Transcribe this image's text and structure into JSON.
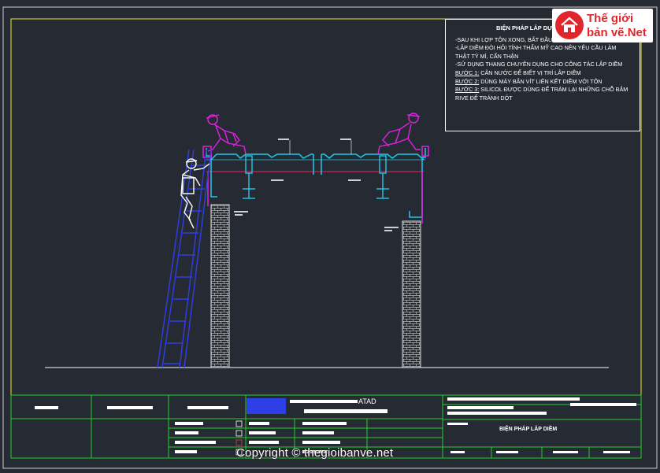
{
  "notes": {
    "title": "BIỆN PHÁP LẮP DỰNG",
    "lines": [
      "-SAU KHI LỢP TÔN XONG, BẮT ĐẦU LẮNG TÁC LẮP DIỀM",
      "-LẮP DIỀM ĐÒI HỎI TÍNH THẨM MỸ CAO NÊN YÊU CẦU LÀM",
      "THẬT TỶ MỈ, CẨN THẬN",
      "-SỬ DỤNG THANG CHUYÊN DỤNG CHO CÔNG TÁC LẮP DIỀM"
    ],
    "steps": [
      {
        "label": "BƯỚC 1:",
        "text": " CÂN NƯỚC ĐỂ BIẾT VỊ TRÍ LẮP DIỀM"
      },
      {
        "label": "BƯỚC 2:",
        "text": " DÙNG MÁY BẮN VÍT LIÊN KẾT DIỀM VỚI TÔN"
      },
      {
        "label": "BƯỚC 3:",
        "text": " SILICOL ĐƯỢC DÙNG ĐỂ TRÁM LẠI NHỮNG CHỖ BẮM"
      }
    ],
    "last_line": "RIVE ĐỂ TRÁNH DỘT"
  },
  "logo": {
    "line1": "Thế giới",
    "line2": "bản vẽ",
    "suffix": ".Net"
  },
  "title_block": {
    "company": "ATAD",
    "company_short": "ATAD",
    "sheet_title": "BIỆN PHÁP LẮP DIỀM"
  },
  "copyright": "Copyright © thegioibanve.net",
  "colors": {
    "background": "#262a33",
    "frame": "#e8e833",
    "titleblock": "#22d02a",
    "worker": "#e022e0",
    "ladder": "#2f3fe8",
    "steel": "#22c8e8",
    "purlin_line": "#cc2255"
  }
}
